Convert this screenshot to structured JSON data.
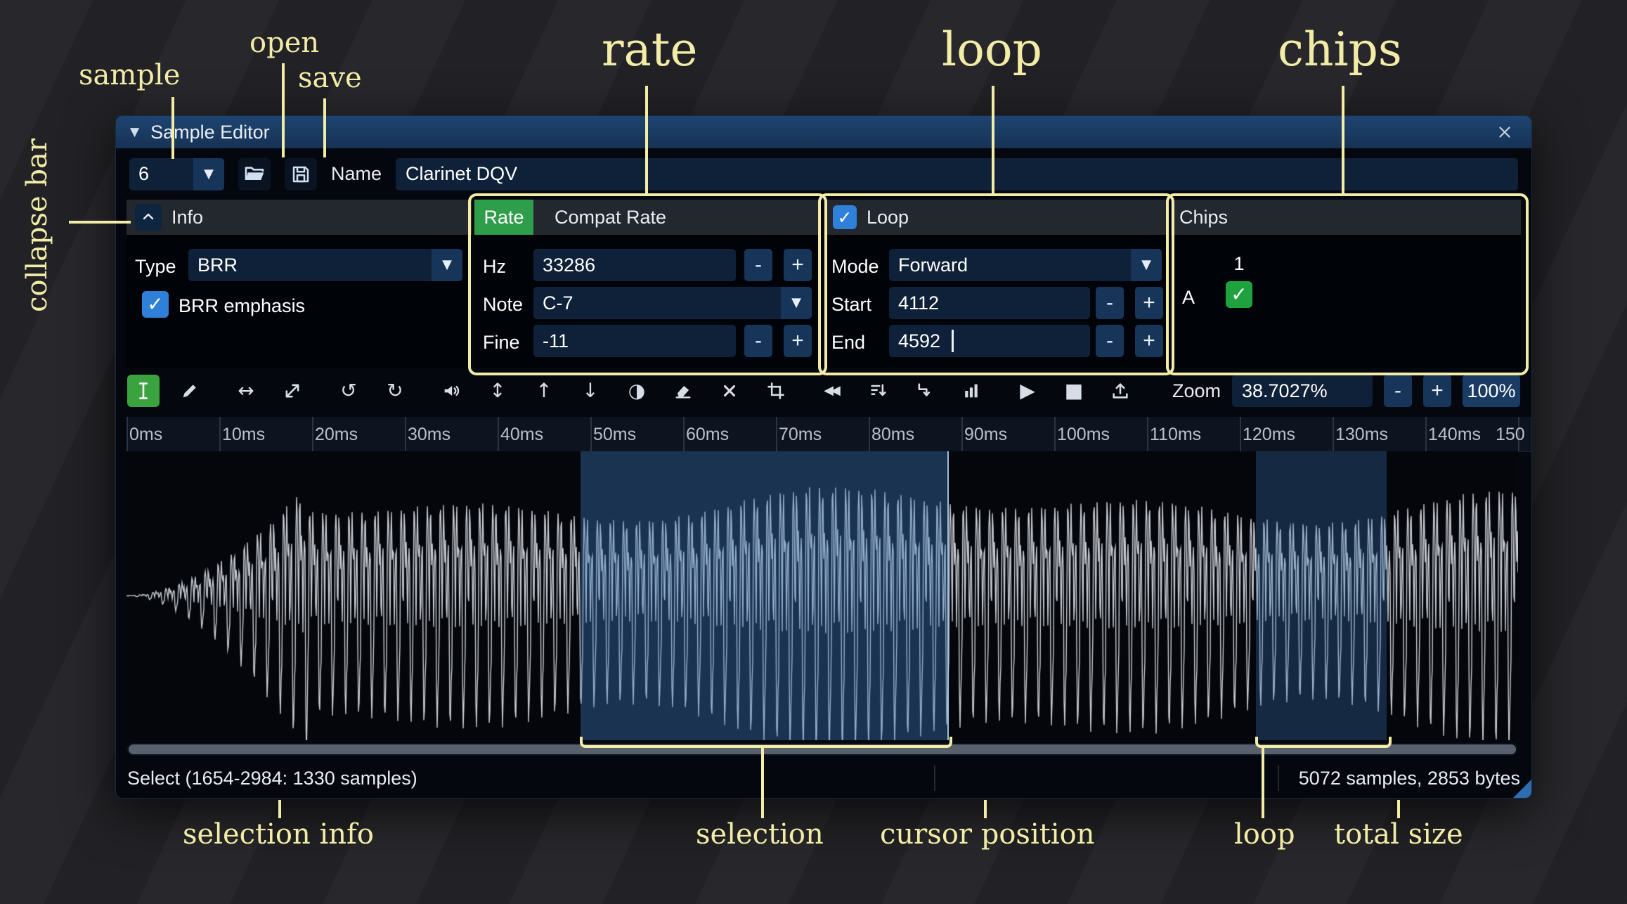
{
  "annotations": {
    "sample": "sample",
    "open": "open",
    "save": "save",
    "rate": "rate",
    "loop": "loop",
    "chips": "chips",
    "collapse_bar": "collapse bar",
    "selection_info": "selection info",
    "selection": "selection",
    "cursor_position": "cursor position",
    "loop_bottom": "loop",
    "total_size": "total size"
  },
  "window": {
    "title": "Sample Editor"
  },
  "controls": {
    "sample_index": "6",
    "name_label": "Name",
    "name_value": "Clarinet DQV"
  },
  "info": {
    "title": "Info",
    "type_label": "Type",
    "type_value": "BRR",
    "emphasis_label": "BRR emphasis",
    "emphasis_checked": true
  },
  "rate": {
    "tab_rate": "Rate",
    "tab_compat": "Compat Rate",
    "hz_label": "Hz",
    "hz_value": "33286",
    "note_label": "Note",
    "note_value": "C-7",
    "fine_label": "Fine",
    "fine_value": "-11"
  },
  "loop": {
    "title": "Loop",
    "checked": true,
    "mode_label": "Mode",
    "mode_value": "Forward",
    "start_label": "Start",
    "start_value": "4112",
    "end_label": "End",
    "end_value": "4592"
  },
  "chips": {
    "title": "Chips",
    "column_1": "1",
    "row_a": "A"
  },
  "toolbar": {
    "zoom_label": "Zoom",
    "zoom_value": "38.7027%",
    "zoom_reset": "100%",
    "icons": [
      "select-mode",
      "draw-mode",
      "resize",
      "resample",
      "undo",
      "redo",
      "amplify",
      "normalize",
      "fade-in",
      "fade-out",
      "invert",
      "silence",
      "delete",
      "trim",
      "reverse",
      "filter",
      "downsample",
      "spectrum",
      "preview",
      "stop-preview",
      "create-wavetable"
    ]
  },
  "steppers": {
    "minus": "-",
    "plus": "+"
  },
  "glyphs": {
    "collapse_triangle": "▼",
    "dropdown_arrow": "▼",
    "undo": "↺",
    "redo": "↻",
    "stretch": "↔",
    "normalize": "↕",
    "fade_in": "↑",
    "fade_out": "↓",
    "invert": "◑",
    "rewind": "◀◀",
    "play": "▶",
    "stop": "■",
    "check": "✓"
  },
  "ruler": {
    "labels": [
      "0ms",
      "10ms",
      "20ms",
      "30ms",
      "40ms",
      "50ms",
      "60ms",
      "70ms",
      "80ms",
      "90ms",
      "100ms",
      "110ms",
      "120ms",
      "130ms",
      "140ms",
      "150"
    ]
  },
  "status": {
    "selection_info": "Select (1654-2984: 1330 samples)",
    "total_size": "5072 samples, 2853 bytes"
  },
  "colors": {
    "annotation_yellow": "#f2eca6",
    "accent_blue": "#2e80d8",
    "accent_green": "#2f9e4a",
    "selection_fill": "rgba(64,126,197,0.38)"
  }
}
